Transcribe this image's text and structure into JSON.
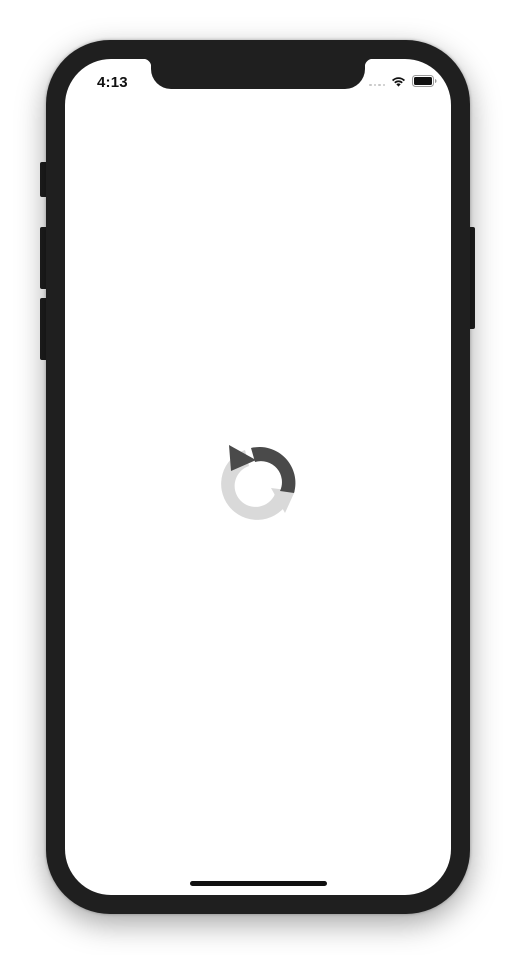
{
  "status_bar": {
    "time": "4:13",
    "wifi_icon": "wifi-icon",
    "battery_icon": "battery-icon",
    "signal_icon": "cellular-signal-icon"
  },
  "main": {
    "loading_icon": "refresh-loading-icon"
  },
  "colors": {
    "frame": "#1f1f1f",
    "screen_background": "#ffffff",
    "spinner_dark": "#4a4a4a",
    "spinner_light": "#d9d9d9",
    "home_indicator": "#111111"
  }
}
